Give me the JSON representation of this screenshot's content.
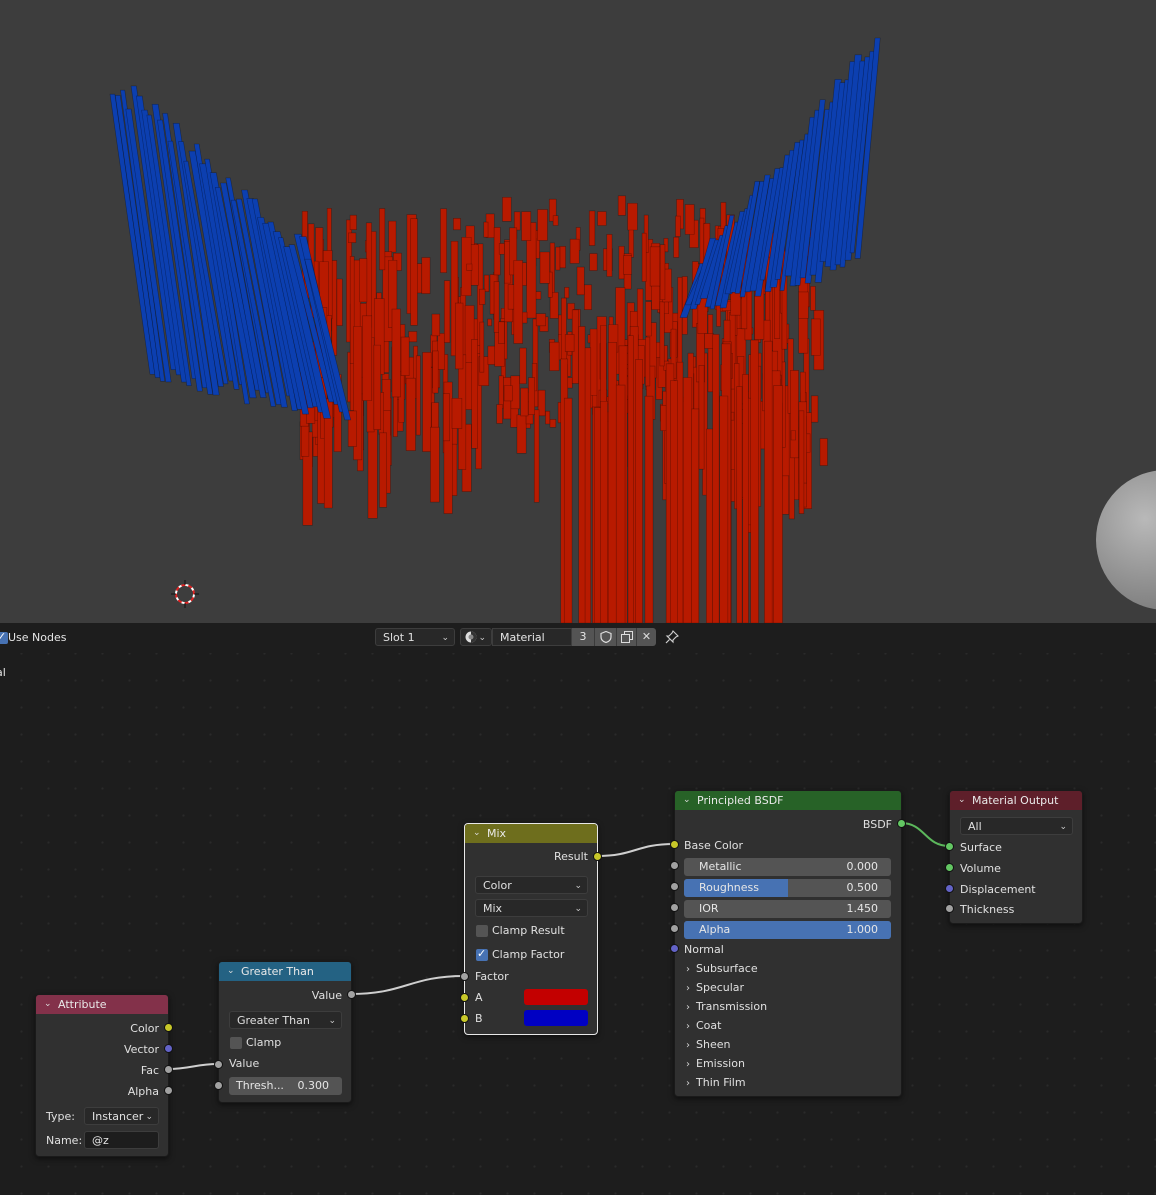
{
  "header": {
    "use_nodes_label": "Use Nodes",
    "slot": "Slot 1",
    "material_name": "Material",
    "user_count": "3",
    "left_edge_label": "al"
  },
  "nodes": {
    "attribute": {
      "title": "Attribute",
      "header_color": "#83314a",
      "outputs": [
        "Color",
        "Vector",
        "Fac",
        "Alpha"
      ],
      "type_label": "Type:",
      "type_value": "Instancer",
      "name_label": "Name:",
      "name_value": "@z"
    },
    "greater_than": {
      "title": "Greater Than",
      "header_color": "#246283",
      "output": "Value",
      "operation": "Greater Than",
      "clamp_label": "Clamp",
      "input_value": "Value",
      "threshold_label": "Thresh...",
      "threshold_value": "0.300"
    },
    "mix": {
      "title": "Mix",
      "header_color": "#6e6e1d",
      "output": "Result",
      "data_type": "Color",
      "blend_mode": "Mix",
      "clamp_result_label": "Clamp Result",
      "clamp_factor_label": "Clamp Factor",
      "factor_label": "Factor",
      "a_label": "A",
      "b_label": "B",
      "a_color": "#c30000",
      "b_color": "#0000c3"
    },
    "principled": {
      "title": "Principled BSDF",
      "header_color": "#276227",
      "output": "BSDF",
      "base_color_label": "Base Color",
      "metallic_label": "Metallic",
      "metallic_value": "0.000",
      "metallic_fraction": 0.0,
      "roughness_label": "Roughness",
      "roughness_value": "0.500",
      "roughness_fraction": 0.5,
      "ior_label": "IOR",
      "ior_value": "1.450",
      "ior_fraction": 0.0,
      "alpha_label": "Alpha",
      "alpha_value": "1.000",
      "alpha_fraction": 1.0,
      "normal_label": "Normal",
      "panels": [
        "Subsurface",
        "Specular",
        "Transmission",
        "Coat",
        "Sheen",
        "Emission",
        "Thin Film"
      ]
    },
    "output": {
      "title": "Material Output",
      "header_color": "#5e1f2a",
      "target": "All",
      "inputs": [
        "Surface",
        "Volume",
        "Displacement",
        "Thickness"
      ]
    }
  },
  "colors": {
    "viewport_bg": "#3d3d3d",
    "red_instances": "#b81a00",
    "blue_instances": "#0c3fb0",
    "link_color": "#cfcfcf",
    "shader_link_color": "#5cb85c"
  },
  "icons": {
    "material_preview": "material-sphere-icon",
    "fake_user": "shield-icon",
    "duplicate": "copy-icon",
    "unlink": "close-icon",
    "pin": "pin-icon",
    "cursor": "3d-cursor-icon"
  }
}
